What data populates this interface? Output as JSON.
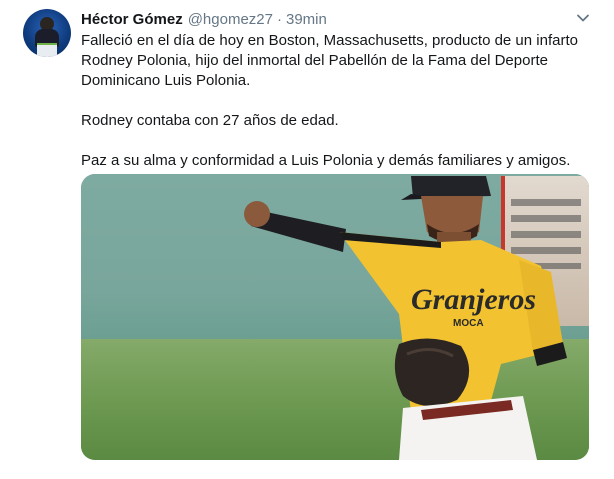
{
  "tweet": {
    "author_name": "Héctor Gómez",
    "handle": "@hgomez27",
    "separator": "·",
    "time": "39min",
    "paragraphs": [
      "Falleció en el día de hoy en Boston, Massachusetts, producto de un infarto Rodney Polonia, hijo del inmortal del Pabellón de la Fama del Deporte Dominicano Luis Polonia.",
      "Rodney contaba con 27 años de edad.",
      "Paz a su alma y conformidad a Luis Polonia y demás familiares y amigos."
    ],
    "jersey_text": "Granjeros",
    "jersey_subtext": "MOCA"
  },
  "icons": {
    "avatar": "avatar",
    "menu": "chevron-down-icon"
  },
  "colors": {
    "name": "#14171a",
    "secondary": "#657786",
    "jersey": "#f2c230",
    "jersey_text": "#2a2a2a"
  }
}
